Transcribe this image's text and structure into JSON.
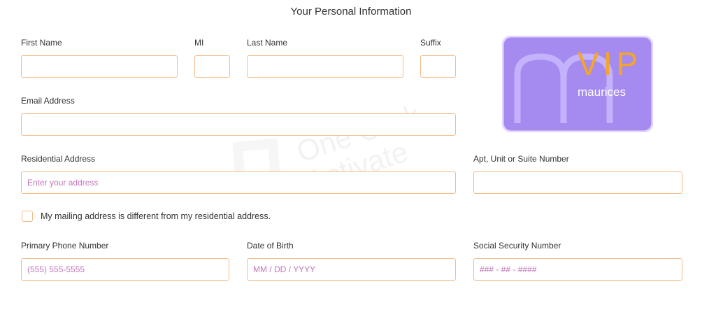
{
  "page": {
    "title": "Your Personal Information"
  },
  "form": {
    "first_name": {
      "label": "First Name",
      "value": ""
    },
    "mi": {
      "label": "MI",
      "value": ""
    },
    "last_name": {
      "label": "Last Name",
      "value": ""
    },
    "suffix": {
      "label": "Suffix",
      "value": ""
    },
    "email": {
      "label": "Email Address",
      "value": ""
    },
    "residential_address": {
      "label": "Residential Address",
      "placeholder": "Enter your address",
      "value": ""
    },
    "apt": {
      "label": "Apt, Unit or Suite Number",
      "value": ""
    },
    "mailing_checkbox": {
      "label": "My mailing address is different from my residential address.",
      "checked": false
    },
    "phone": {
      "label": "Primary Phone Number",
      "placeholder": "(555) 555-5555"
    },
    "dob": {
      "label": "Date of Birth",
      "placeholder": "MM / DD / YYYY"
    },
    "ssn": {
      "label": "Social Security Number",
      "placeholder": "### - ## - ####"
    }
  },
  "card": {
    "badge": "VIP",
    "brand": "maurices"
  },
  "watermark": {
    "line1": "One Click",
    "line2": "Activate"
  },
  "colors": {
    "field_border": "#f6bb8a",
    "placeholder": "#b85fb0",
    "card_bg": "#a58af0",
    "vip_text": "#f5a623"
  }
}
